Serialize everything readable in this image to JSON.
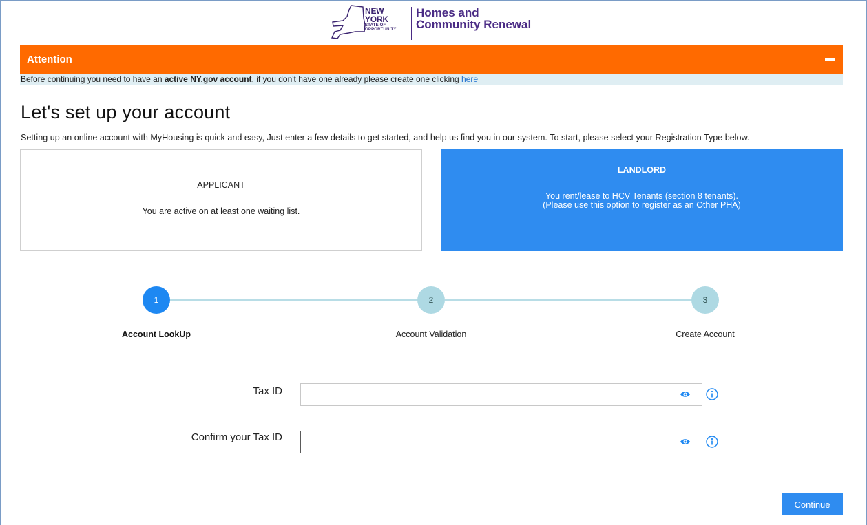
{
  "header": {
    "logo": {
      "line1": "NEW YORK",
      "line2": "STATE OF",
      "line3": "OPPORTUNITY.",
      "agency_line1": "Homes and",
      "agency_line2": "Community Renewal"
    }
  },
  "attention": {
    "title": "Attention",
    "notice_before": "Before continuing you need to have an ",
    "notice_bold": "active NY.gov account",
    "notice_after": ", if you don't have one already please create one clicking ",
    "notice_link": "here"
  },
  "page": {
    "title": "Let's set up your account",
    "intro": "Setting up an online account with MyHousing is quick and easy, Just enter a few details to get started, and help us find you in our system. To start, please select your Registration Type below."
  },
  "registration_types": [
    {
      "title": "APPLICANT",
      "description": "You are active on at least one waiting list.",
      "selected": false
    },
    {
      "title": "LANDLORD",
      "description": "You rent/lease to HCV Tenants (section 8 tenants).\n(Please use this option to register as an Other PHA)",
      "selected": true
    }
  ],
  "steps": [
    {
      "number": "1",
      "label": "Account LookUp",
      "active": true
    },
    {
      "number": "2",
      "label": "Account Validation",
      "active": false
    },
    {
      "number": "3",
      "label": "Create Account",
      "active": false
    }
  ],
  "form": {
    "tax_id": {
      "label": "Tax ID",
      "value": ""
    },
    "confirm_tax_id": {
      "label": "Confirm your Tax ID",
      "value": ""
    }
  },
  "actions": {
    "continue_label": "Continue"
  },
  "colors": {
    "attention_bg": "#ff6a00",
    "primary": "#2f8cf0",
    "agency": "#4a2b85",
    "step_inactive": "#aed9e3"
  }
}
